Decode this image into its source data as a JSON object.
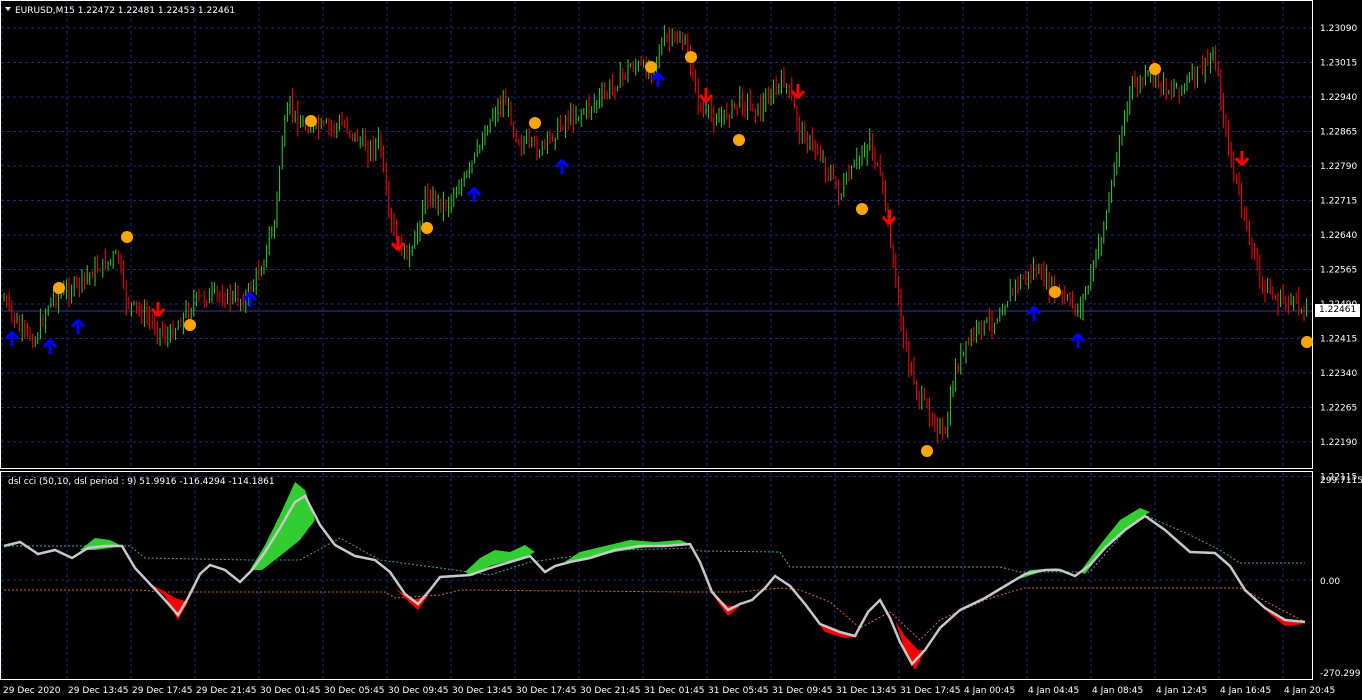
{
  "main_chart": {
    "header": "EURUSD,M15  1.22472 1.22481 1.22453 1.22461",
    "price_axis": [
      "1.23090",
      "1.23015",
      "1.22940",
      "1.22865",
      "1.22790",
      "1.22715",
      "1.22640",
      "1.22565",
      "1.22490",
      "1.22415",
      "1.22340",
      "1.22265",
      "1.22190",
      "1.22115"
    ],
    "current_price": "1.22461",
    "colors": {
      "bull_candle": "#32cd32",
      "bear_candle": "#ff0000",
      "up_arrow": "#0000ff",
      "down_arrow": "#ff0000",
      "dot": "#ffa500",
      "grid": "#1c2a78",
      "price_line": "#3a3aa0"
    }
  },
  "indicator": {
    "header": "dsl cci (50,10, dsl period : 9) 51.9916 -116.4294 -114.1861",
    "axis": {
      "top": "299.7115",
      "zero": "0.00",
      "bottom": "-270.299"
    },
    "colors": {
      "fill_pos": "#32cd32",
      "fill_neg": "#ff0000",
      "cci_line": "#c8c8c8",
      "upper_level": "#4aa3a3",
      "lower_level": "#d0703a"
    }
  },
  "time_axis": [
    "29 Dec 2020",
    "29 Dec 13:45",
    "29 Dec 17:45",
    "29 Dec 21:45",
    "30 Dec 01:45",
    "30 Dec 05:45",
    "30 Dec 09:45",
    "30 Dec 13:45",
    "30 Dec 17:45",
    "30 Dec 21:45",
    "31 Dec 01:45",
    "31 Dec 05:45",
    "31 Dec 09:45",
    "31 Dec 13:45",
    "31 Dec 17:45",
    "4 Jan 00:45",
    "4 Jan 04:45",
    "4 Jan 08:45",
    "4 Jan 12:45",
    "4 Jan 16:45",
    "4 Jan 20:45"
  ]
}
